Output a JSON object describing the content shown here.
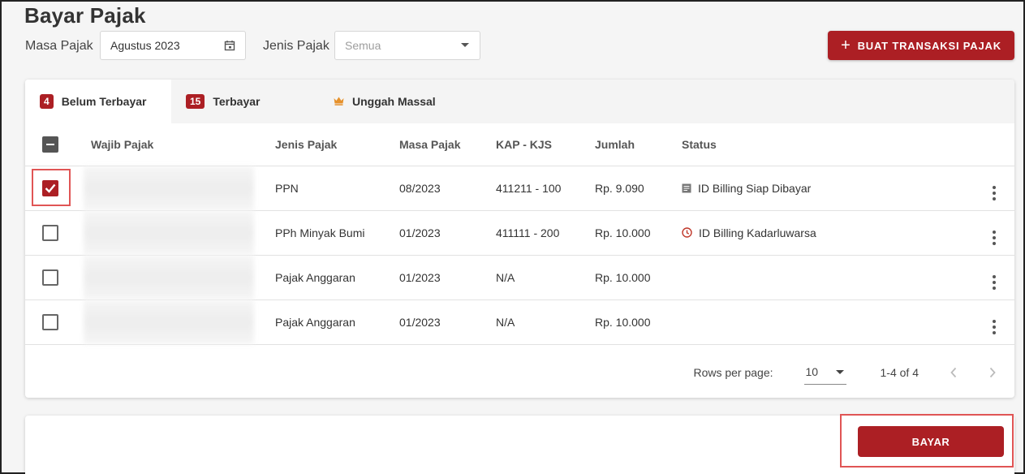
{
  "header": {
    "title": "Bayar Pajak",
    "masa_pajak_label": "Masa Pajak",
    "masa_pajak_value": "Agustus 2023",
    "jenis_pajak_label": "Jenis Pajak",
    "jenis_pajak_placeholder": "Semua",
    "create_button": "BUAT TRANSAKSI PAJAK"
  },
  "tabs": [
    {
      "count": "4",
      "label": "Belum Terbayar",
      "active": true
    },
    {
      "count": "15",
      "label": "Terbayar",
      "active": false
    },
    {
      "icon": "crown-icon",
      "label": "Unggah Massal",
      "active": false
    }
  ],
  "table": {
    "columns": [
      "Wajib Pajak",
      "Jenis Pajak",
      "Masa Pajak",
      "KAP - KJS",
      "Jumlah",
      "Status"
    ],
    "rows": [
      {
        "checked": true,
        "jenis": "PPN",
        "masa": "08/2023",
        "kap": "411211 - 100",
        "jumlah": "Rp. 9.090",
        "status": "ID Billing Siap Dibayar",
        "status_icon": "document-icon"
      },
      {
        "checked": false,
        "jenis": "PPh Minyak Bumi",
        "masa": "01/2023",
        "kap": "411111 - 200",
        "jumlah": "Rp. 10.000",
        "status": "ID Billing Kadarluwarsa",
        "status_icon": "clock-icon"
      },
      {
        "checked": false,
        "jenis": "Pajak Anggaran",
        "masa": "01/2023",
        "kap": "N/A",
        "jumlah": "Rp. 10.000",
        "status": "",
        "status_icon": ""
      },
      {
        "checked": false,
        "jenis": "Pajak Anggaran",
        "masa": "01/2023",
        "kap": "N/A",
        "jumlah": "Rp. 10.000",
        "status": "",
        "status_icon": ""
      }
    ]
  },
  "pagination": {
    "rows_per_page_label": "Rows per page:",
    "rows_per_page_value": "10",
    "range": "1-4 of 4"
  },
  "footer": {
    "pay_button": "BAYAR"
  },
  "colors": {
    "brand_red": "#ac1f24",
    "highlight_red": "#e05555",
    "crown_orange": "#e6912b"
  }
}
